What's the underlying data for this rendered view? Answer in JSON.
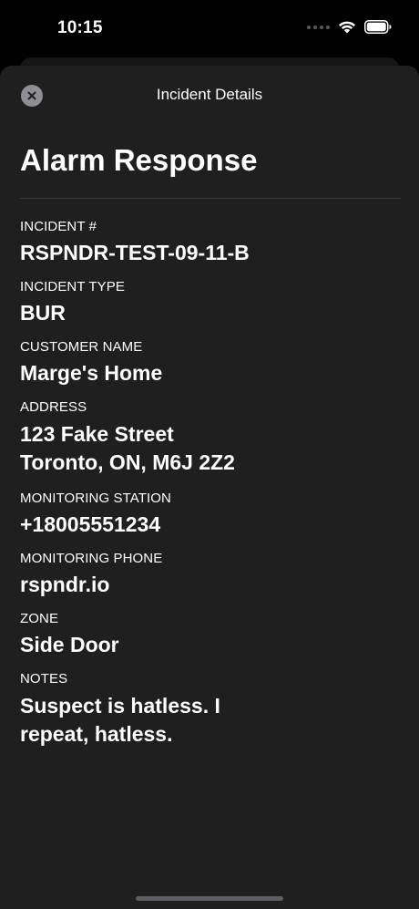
{
  "status_bar": {
    "time": "10:15"
  },
  "sheet": {
    "header_title": "Incident Details",
    "page_title": "Alarm Response"
  },
  "fields": [
    {
      "label": "INCIDENT #",
      "value": "RSPNDR-TEST-09-11-B"
    },
    {
      "label": "INCIDENT TYPE",
      "value": "BUR"
    },
    {
      "label": "CUSTOMER NAME",
      "value": "Marge's Home"
    },
    {
      "label": "ADDRESS",
      "value": "123 Fake Street\nToronto, ON, M6J 2Z2"
    },
    {
      "label": "MONITORING STATION",
      "value": "+18005551234"
    },
    {
      "label": "MONITORING PHONE",
      "value": "rspndr.io"
    },
    {
      "label": "ZONE",
      "value": "Side Door"
    },
    {
      "label": "NOTES",
      "value": "Suspect is hatless. I\nrepeat, hatless."
    }
  ],
  "icons": {
    "close": "close-icon",
    "wifi": "wifi-icon",
    "battery": "battery-icon",
    "signal": "cellular-signal-icon"
  },
  "colors": {
    "background": "#000000",
    "sheet": "#1f1f20",
    "close_button": "#8e8e93"
  }
}
